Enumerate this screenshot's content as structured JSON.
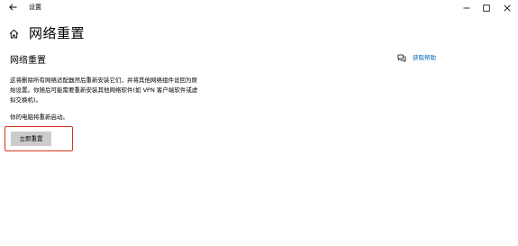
{
  "titlebar": {
    "app_title": "设置",
    "back_icon": "back-arrow-icon",
    "minimize_icon": "minimize-icon",
    "maximize_icon": "maximize-icon",
    "close_icon": "close-icon"
  },
  "header": {
    "home_icon": "home-icon",
    "title": "网络重置"
  },
  "section": {
    "heading": "网络重置",
    "description_line1": "这将删除所有网络适配器然后重新安装它们，并将其他网络组件设回为原",
    "description_line2": "始设置。你随后可能需要重新安装其他网络软件(如 VPN 客户端软件或虚",
    "description_line3": "拟交换机)。",
    "restart_note": "你的电脑将重新启动。",
    "reset_button_label": "立即重置"
  },
  "help": {
    "icon": "chat-help-icon",
    "label": "获取帮助"
  },
  "colors": {
    "accent_link": "#0063b1",
    "button_bg": "#cccccc",
    "highlight_border": "#d9341e"
  }
}
